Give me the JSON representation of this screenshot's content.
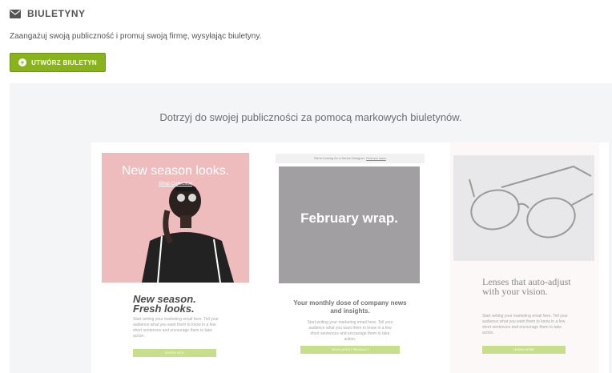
{
  "header": {
    "title": "BIULETYNY",
    "icon": "envelope-icon",
    "description": "Zaangażuj swoją publiczność i promuj swoją firmę, wysyłając biuletyny."
  },
  "create_button": {
    "label": "UTWÓRZ BIULETYN",
    "icon": "plus-circle-icon",
    "color": "#88b31d"
  },
  "panel": {
    "tagline": "Dotrzyj do swojej publiczności za pomocą markowych biuletynów."
  },
  "templates": [
    {
      "hero_title": "New season looks.",
      "hero_link": "Shop Collection",
      "heading_line1": "New season.",
      "heading_line2": "Fresh looks.",
      "body": "Start writing your marketing email here. Tell your audience what you want them to know in a few short sentences and encourage them to take action.",
      "cta": "ENTER SITE",
      "hero_color": "#efbcbd"
    },
    {
      "top_bar_text": "We're looking for a Senior Designer.",
      "top_bar_link": "Find out more",
      "hero_title": "February wrap.",
      "heading": "Your monthly dose of company news and insights.",
      "body": "Start writing your marketing email here. Tell your audience what you want them to know in a few short sentences and encourage them to take action.",
      "cta": "VIEW LATEST PRODUCT",
      "hero_color": "#a29fa2"
    },
    {
      "heading": "Lenses that auto-adjust with your vision.",
      "body": "Start writing your marketing email here. Tell your audience what you want them to know in a few short sentences and encourage them to take action.",
      "cta": "LEARN MORE",
      "hero_color": "#e8e7e9"
    }
  ]
}
